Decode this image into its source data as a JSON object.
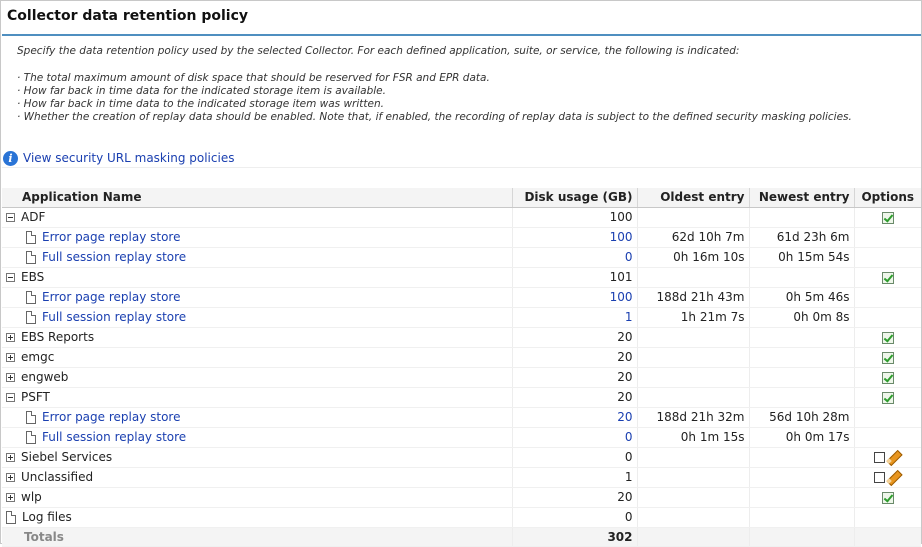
{
  "title": "Collector data retention policy",
  "description": "Specify the data retention policy used by the selected Collector. For each defined application, suite, or service, the following is indicated:",
  "bullets": [
    "· The total maximum amount of disk space that should be reserved for FSR and EPR data.",
    "· How far back in time data for the indicated storage item is available.",
    "· How far back in time data to the indicated storage item was written.",
    "· Whether the creation of replay data should be enabled. Note that, if enabled, the recording of replay data is subject to the defined security masking policies."
  ],
  "security_link": "View security URL masking policies",
  "columns": {
    "name": "Application Name",
    "disk": "Disk usage (GB)",
    "oldest": "Oldest entry",
    "newest": "Newest entry",
    "options": "Options"
  },
  "rows": [
    {
      "name": "ADF",
      "disk": "100"
    },
    {
      "name": "Error page replay store",
      "disk": "100",
      "oldest": "62d 10h 7m",
      "newest": "61d 23h 6m"
    },
    {
      "name": "Full session replay store",
      "disk": "0",
      "oldest": "0h 16m 10s",
      "newest": "0h 15m 54s"
    },
    {
      "name": "EBS",
      "disk": "101"
    },
    {
      "name": "Error page replay store",
      "disk": "100",
      "oldest": "188d 21h 43m",
      "newest": "0h 5m 46s"
    },
    {
      "name": "Full session replay store",
      "disk": "1",
      "oldest": "1h 21m 7s",
      "newest": "0h 0m 8s"
    },
    {
      "name": "EBS Reports",
      "disk": "20"
    },
    {
      "name": "emgc",
      "disk": "20"
    },
    {
      "name": "engweb",
      "disk": "20"
    },
    {
      "name": "PSFT",
      "disk": "20"
    },
    {
      "name": "Error page replay store",
      "disk": "20",
      "oldest": "188d 21h 32m",
      "newest": "56d 10h 28m"
    },
    {
      "name": "Full session replay store",
      "disk": "0",
      "oldest": "0h 1m 15s",
      "newest": "0h 0m 17s"
    },
    {
      "name": "Siebel Services",
      "disk": "0"
    },
    {
      "name": "Unclassified",
      "disk": "1"
    },
    {
      "name": "wlp",
      "disk": "20"
    },
    {
      "name": "Log files",
      "disk": "0"
    }
  ],
  "totals": {
    "label": "Totals",
    "disk": "302"
  },
  "colors": {
    "accent": "#4f8fc0",
    "link": "#1a3fb0",
    "check": "#2e9d2e"
  }
}
